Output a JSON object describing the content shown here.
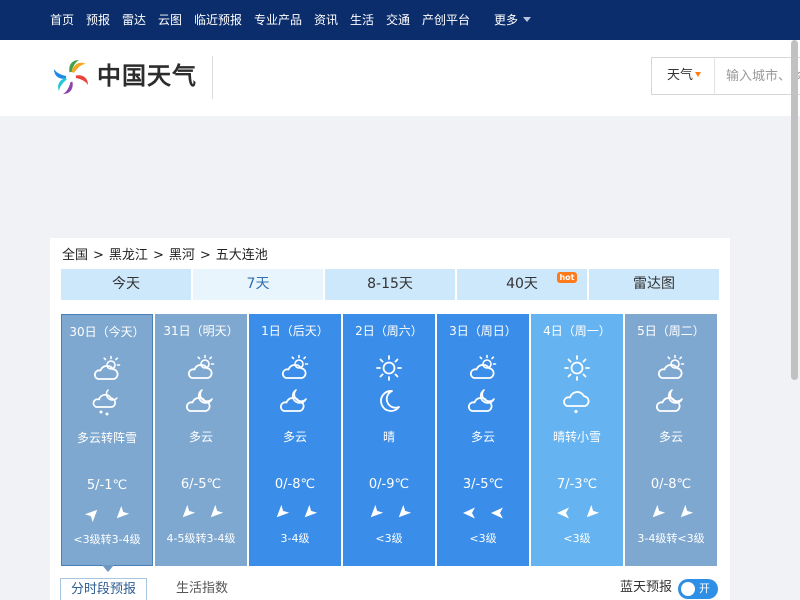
{
  "nav": {
    "items": [
      "首页",
      "预报",
      "雷达",
      "云图",
      "临近预报",
      "专业产品",
      "资讯",
      "生活",
      "交通",
      "产创平台"
    ],
    "more": "更多"
  },
  "header": {
    "logo_text": "中国天气",
    "search_type": "天气",
    "search_placeholder": "输入城市、乡镇、街道"
  },
  "breadcrumb": [
    "全国",
    "黑龙江",
    "黑河",
    "五大连池"
  ],
  "breadcrumb_sep": ">",
  "tabs": [
    {
      "label": "今天",
      "active": false
    },
    {
      "label": "7天",
      "active": true
    },
    {
      "label": "8-15天",
      "active": false
    },
    {
      "label": "40天",
      "active": false,
      "badge": "hot"
    },
    {
      "label": "雷达图",
      "active": false
    }
  ],
  "days": [
    {
      "date": "30日（今天）",
      "day_icon": "partly-cloudy-day-icon",
      "night_icon": "snow-night-icon",
      "weather": "多云转阵雪",
      "temp": "5/-1℃",
      "wind_day": "northeast-wind-icon",
      "wind_night": "southwest-wind-icon",
      "level": "<3级转3-4级",
      "bg": "#7fa8d0",
      "selected": true
    },
    {
      "date": "31日（明天）",
      "day_icon": "partly-cloudy-day-icon",
      "night_icon": "partly-cloudy-night-icon",
      "weather": "多云",
      "temp": "6/-5℃",
      "wind_day": "southwest-wind-icon",
      "wind_night": "southwest-wind-icon",
      "level": "4-5级转3-4级",
      "bg": "#7fa8d0",
      "selected": false
    },
    {
      "date": "1日（后天）",
      "day_icon": "partly-cloudy-day-icon",
      "night_icon": "partly-cloudy-night-icon",
      "weather": "多云",
      "temp": "0/-8℃",
      "wind_day": "southwest-wind-icon",
      "wind_night": "southwest-wind-icon",
      "level": "3-4级",
      "bg": "#3a8de8",
      "selected": false
    },
    {
      "date": "2日（周六）",
      "day_icon": "sun-icon",
      "night_icon": "moon-icon",
      "weather": "晴",
      "temp": "0/-9℃",
      "wind_day": "southwest-wind-icon",
      "wind_night": "southwest-wind-icon",
      "level": "<3级",
      "bg": "#3a8de8",
      "selected": false
    },
    {
      "date": "3日（周日）",
      "day_icon": "partly-cloudy-day-icon",
      "night_icon": "partly-cloudy-night-icon",
      "weather": "多云",
      "temp": "3/-5℃",
      "wind_day": "west-wind-icon",
      "wind_night": "west-wind-icon",
      "level": "<3级",
      "bg": "#3a8de8",
      "selected": false
    },
    {
      "date": "4日（周一）",
      "day_icon": "sun-icon",
      "night_icon": "snow-cloud-icon",
      "weather": "晴转小雪",
      "temp": "7/-3℃",
      "wind_day": "west-wind-icon",
      "wind_night": "southwest-wind-icon",
      "level": "<3级",
      "bg": "#65b3f0",
      "selected": false
    },
    {
      "date": "5日（周二）",
      "day_icon": "partly-cloudy-day-icon",
      "night_icon": "partly-cloudy-night-icon",
      "weather": "多云",
      "temp": "0/-8℃",
      "wind_day": "southwest-wind-icon",
      "wind_night": "southwest-wind-icon",
      "level": "3-4级转<3级",
      "bg": "#7fa8d0",
      "selected": false
    }
  ],
  "bottom_tabs": [
    "分时段预报",
    "生活指数"
  ],
  "bluesky": {
    "label": "蓝天预报",
    "toggle_text": "开",
    "on": true
  },
  "colors": {
    "nav_bg": "#0c2d6b",
    "tab_bg": "#cde7fb",
    "tab_active_text": "#2f6fb3",
    "accent": "#2e8fe6"
  }
}
